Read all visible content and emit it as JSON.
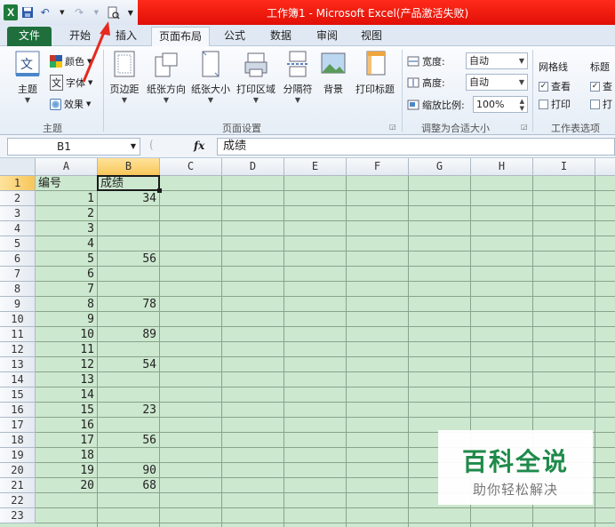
{
  "window": {
    "title": "工作簿1 - Microsoft Excel(产品激活失败)",
    "accent_color": "#e8150a",
    "quick_access": [
      "excel-logo-icon",
      "save-icon",
      "undo-icon",
      "redo-icon",
      "print-preview-icon",
      "customize-icon"
    ],
    "excel_logo_letter": "X"
  },
  "tabs": [
    {
      "label": "文件"
    },
    {
      "label": "开始"
    },
    {
      "label": "插入"
    },
    {
      "label": "页面布局"
    },
    {
      "label": "公式"
    },
    {
      "label": "数据"
    },
    {
      "label": "审阅"
    },
    {
      "label": "视图"
    }
  ],
  "active_tab": "页面布局",
  "ribbon": {
    "theme_group": {
      "label": "主题",
      "themes_button": "主题",
      "colors": "颜色",
      "fonts": "字体",
      "effects": "效果"
    },
    "page_setup_group": {
      "label": "页面设置",
      "buttons": [
        "页边距",
        "纸张方向",
        "纸张大小",
        "打印区域",
        "分隔符",
        "背景",
        "打印标题"
      ]
    },
    "scale_group": {
      "label": "调整为合适大小",
      "width_label": "宽度:",
      "width_value": "自动",
      "height_label": "高度:",
      "height_value": "自动",
      "scale_label": "缩放比例:",
      "scale_value": "100%"
    },
    "sheet_options_group": {
      "label": "工作表选项",
      "gridlines_label": "网格线",
      "headings_label": "标题",
      "view_label": "查看",
      "print_label": "打印",
      "headings_view_partial": "查",
      "headings_print_partial": "打"
    }
  },
  "formula_bar": {
    "name_box": "B1",
    "fx_label": "fx",
    "content": "成绩"
  },
  "sheet": {
    "columns": [
      "A",
      "B",
      "C",
      "D",
      "E",
      "F",
      "G",
      "H",
      "I"
    ],
    "selected_column": "B",
    "rows": [
      "1",
      "2",
      "3",
      "4",
      "5",
      "6",
      "7",
      "8",
      "9",
      "10",
      "11",
      "12",
      "13",
      "14",
      "15",
      "16",
      "17",
      "18",
      "19",
      "20",
      "21",
      "22",
      "23"
    ],
    "selected_row": "1",
    "header_a": "编号",
    "header_b": "成绩",
    "col_a": [
      "1",
      "2",
      "3",
      "4",
      "5",
      "6",
      "7",
      "8",
      "9",
      "10",
      "11",
      "12",
      "13",
      "14",
      "15",
      "16",
      "17",
      "18",
      "19",
      "20"
    ],
    "col_b": [
      "34",
      "",
      "",
      "",
      "56",
      "",
      "",
      "78",
      "",
      "89",
      "",
      "54",
      "",
      "",
      "23",
      "",
      "56",
      "",
      "90",
      "68"
    ]
  },
  "watermark": {
    "title": "百科全说",
    "subtitle": "助你轻松解决"
  }
}
